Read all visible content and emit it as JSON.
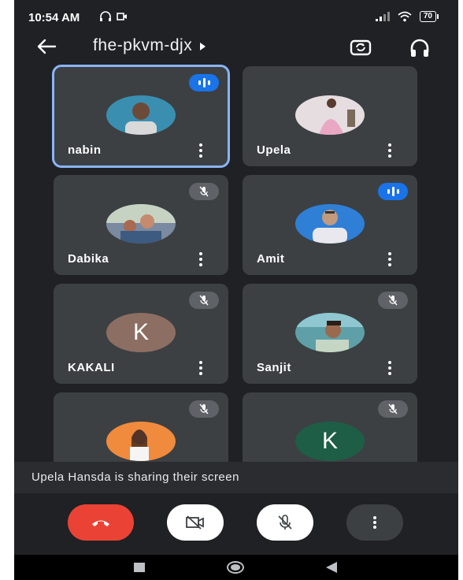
{
  "status_bar": {
    "time": "10:54 AM",
    "battery": "70"
  },
  "meeting": {
    "code": "fhe-pkvm-djx"
  },
  "participants": [
    {
      "name": "nabin",
      "state": "speaking",
      "active": true,
      "avatar_color": "#3a8fb0"
    },
    {
      "name": "Upela",
      "state": "none",
      "active": false,
      "avatar_color": "#d9c7cc"
    },
    {
      "name": "Dabika",
      "state": "muted",
      "active": false,
      "avatar_color": "#7a8aa0"
    },
    {
      "name": "Amit",
      "state": "speaking",
      "active": false,
      "avatar_color": "#2f7fd6"
    },
    {
      "name": "KAKALI",
      "state": "muted",
      "active": false,
      "avatar_color": "#8d6e63",
      "initial": "K"
    },
    {
      "name": "Sanjit",
      "state": "muted",
      "active": false,
      "avatar_color": "#5fa0a8"
    },
    {
      "name": "",
      "state": "muted",
      "active": false,
      "avatar_color": "#f08a3c"
    },
    {
      "name": "",
      "state": "muted",
      "active": false,
      "avatar_color": "#1e5e46",
      "initial": "K"
    }
  ],
  "banner": {
    "text": "Upela Hansda is sharing their screen"
  },
  "colors": {
    "background": "#202124",
    "tile": "#3c4043",
    "accent": "#1a73e8",
    "end_call": "#ea4335"
  }
}
